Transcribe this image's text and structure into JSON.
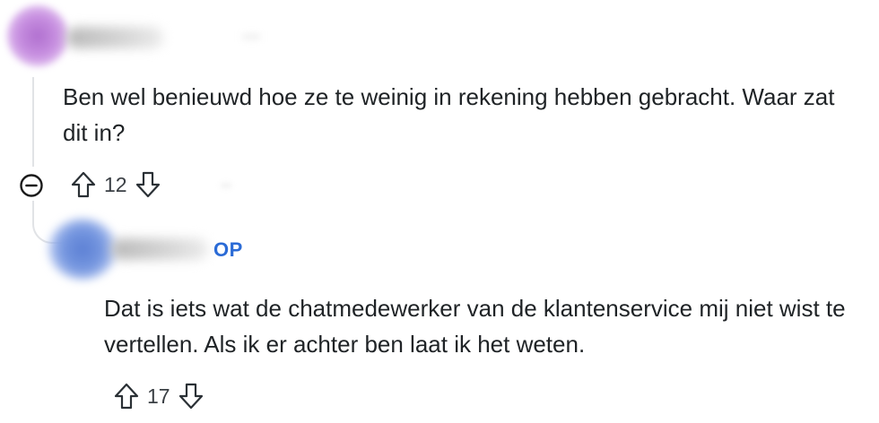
{
  "comments": [
    {
      "text": "Ben wel benieuwd hoe ze te weinig in rekening hebben gebracht. Waar zat dit in?",
      "score": "12",
      "avatar_color": "#b06fcf"
    },
    {
      "badge": "OP",
      "text": "Dat is iets wat de chatmedewerker van de klantenservice mij niet wist te vertellen. Als ik er achter ben laat ik het weten.",
      "score": "17",
      "avatar_color": "#5b7fd4",
      "badge_color": "#2b6bd6"
    }
  ],
  "icons": {
    "collapse": "minus-circle-icon",
    "upvote": "arrow-up-icon",
    "downvote": "arrow-down-icon"
  }
}
